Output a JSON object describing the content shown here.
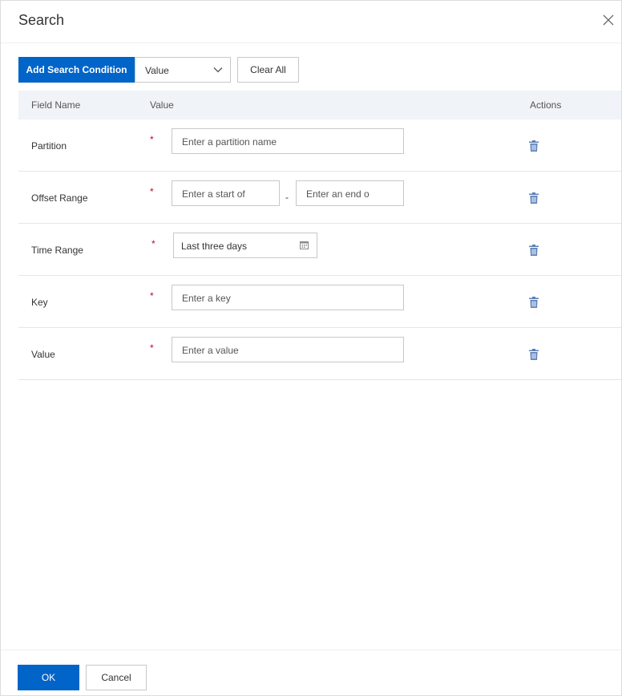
{
  "dialog": {
    "title": "Search"
  },
  "toolbar": {
    "add_condition_label": "Add Search Condition",
    "condition_select_value": "Value",
    "clear_all_label": "Clear All"
  },
  "table": {
    "headers": {
      "field_name": "Field Name",
      "value": "Value",
      "actions": "Actions"
    },
    "rows": [
      {
        "field": "Partition",
        "required": "*",
        "placeholder": "Enter a partition name"
      },
      {
        "field": "Offset Range",
        "required": "*",
        "start_placeholder": "Enter a start of",
        "separator": "-",
        "end_placeholder": "Enter an end o"
      },
      {
        "field": "Time Range",
        "required": "*",
        "value": "Last three days"
      },
      {
        "field": "Key",
        "required": "*",
        "placeholder": "Enter a key"
      },
      {
        "field": "Value",
        "required": "*",
        "placeholder": "Enter a value"
      }
    ]
  },
  "footer": {
    "ok_label": "OK",
    "cancel_label": "Cancel"
  },
  "colors": {
    "primary": "#0064c8",
    "required": "#d0021b",
    "header_bg": "#f0f3f7",
    "icon": "#5a7fb8"
  },
  "icons": {
    "close": "close-icon",
    "chevron": "chevron-down-icon",
    "calendar": "calendar-icon",
    "delete": "trash-icon"
  }
}
